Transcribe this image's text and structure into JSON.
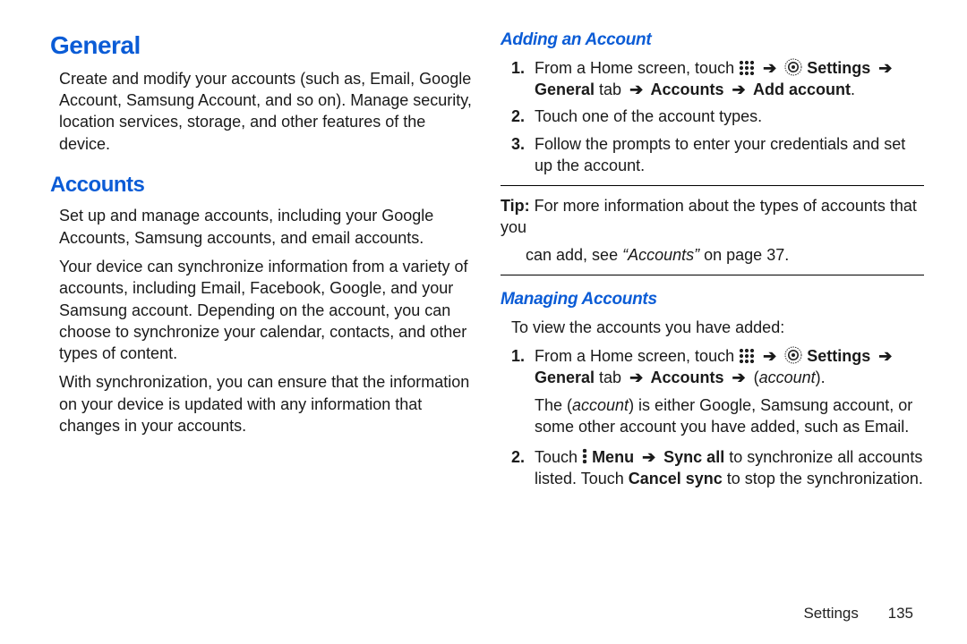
{
  "left": {
    "h_general": "General",
    "general_p": "Create and modify your accounts (such as, Email, Google Account, Samsung Account, and so on). Manage security, location services, storage, and other features of the device.",
    "h_accounts": "Accounts",
    "acc_p1": "Set up and manage accounts, including your Google Accounts, Samsung accounts, and email accounts.",
    "acc_p2": "Your device can synchronize information from a variety of accounts, including Email, Facebook, Google, and your Samsung account. Depending on the account, you can choose to synchronize your calendar, contacts, and other types of content.",
    "acc_p3": "With synchronization, you can ensure that the information on your device is updated with any information that changes in your accounts."
  },
  "right": {
    "h_adding": "Adding an Account",
    "add": {
      "s1_pre": "From a Home screen, touch ",
      "s1_settings": " Settings ",
      "s1_general": "General",
      "s1_tab": " tab ",
      "s1_accounts": " Accounts ",
      "s1_addacct": " Add account",
      "s2": "Touch one of the account types.",
      "s3": "Follow the prompts to enter your credentials and set up the account."
    },
    "tip_label": "Tip:",
    "tip_text": " For more information about the types of accounts that you",
    "tip_text2": "can add, see ",
    "tip_ref": "“Accounts”",
    "tip_page": " on page 37.",
    "h_managing": "Managing Accounts",
    "man_intro": "To view the accounts you have added:",
    "man": {
      "s1_pre": "From a Home screen, touch ",
      "s1_settings": " Settings ",
      "s1_general": "General",
      "s1_tab": " tab ",
      "s1_accounts": " Accounts ",
      "s1_open": " (",
      "s1_account_it": "account",
      "s1_close": ").",
      "s1_expl_a": "The (",
      "s1_expl_it": "account",
      "s1_expl_b": ") is either Google, Samsung account, or some other account you have added, such as Email.",
      "s2_touch": "Touch ",
      "s2_menu": " Menu ",
      "s2_syncall": " Sync all",
      "s2_rest": " to synchronize all accounts listed. Touch ",
      "s2_cancel": "Cancel sync",
      "s2_end": " to stop the synchronization."
    }
  },
  "arrow": "➔",
  "footer": {
    "section": "Settings",
    "page": "135"
  }
}
